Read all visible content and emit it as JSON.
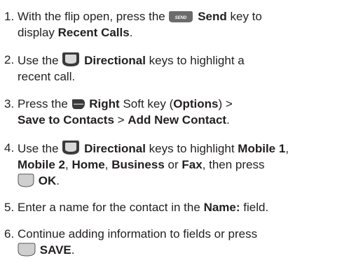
{
  "steps": [
    {
      "number": "1.",
      "lines": [
        {
          "pre": "With the flip open, press the",
          "key": "Send",
          "post": "key to"
        },
        {
          "bold1": "Recent Calls",
          "pre": "display",
          "post": "."
        }
      ]
    },
    {
      "number": "2.",
      "lines": [
        {
          "pre": "Use the",
          "key": "Directional",
          "post": "keys to highlight a"
        },
        {
          "text": "recent call."
        }
      ]
    },
    {
      "number": "3.",
      "lines": [
        {
          "pre": "Press the",
          "key": "Right",
          "mid": "Soft key (",
          "bold": "Options",
          "post": ") >"
        },
        {
          "a": "Save to Contacts",
          "sep": ">",
          "b": "Add New Contact",
          "post": "."
        }
      ]
    },
    {
      "number": "4.",
      "lines": [
        {
          "pre": "Use the",
          "key": "Directional",
          "mid": "keys to highlight",
          "bold": "Mobile 1",
          "post": ","
        },
        {
          "a": "Mobile 2",
          "c1": ",",
          "b": "Home",
          "c2": ",",
          "c": "Business",
          "or": "or",
          "d": "Fax",
          "post": ", then press"
        },
        {
          "key": "OK",
          "post": "."
        }
      ]
    },
    {
      "number": "5.",
      "lines": [
        {
          "pre": "Enter a name for the contact in the",
          "bold": "Name:",
          "post": "field."
        }
      ]
    },
    {
      "number": "6.",
      "lines": [
        {
          "text": "Continue adding information to fields or press"
        },
        {
          "key": "SAVE",
          "post": "."
        }
      ]
    }
  ],
  "icons": {
    "send_key_label": "SEND"
  },
  "colors": {
    "send_key_fill": "#6b6b6b",
    "key_fill": "#3a3a3a",
    "soft_key_fill": "#cfcfcf",
    "text": "#231f20"
  }
}
